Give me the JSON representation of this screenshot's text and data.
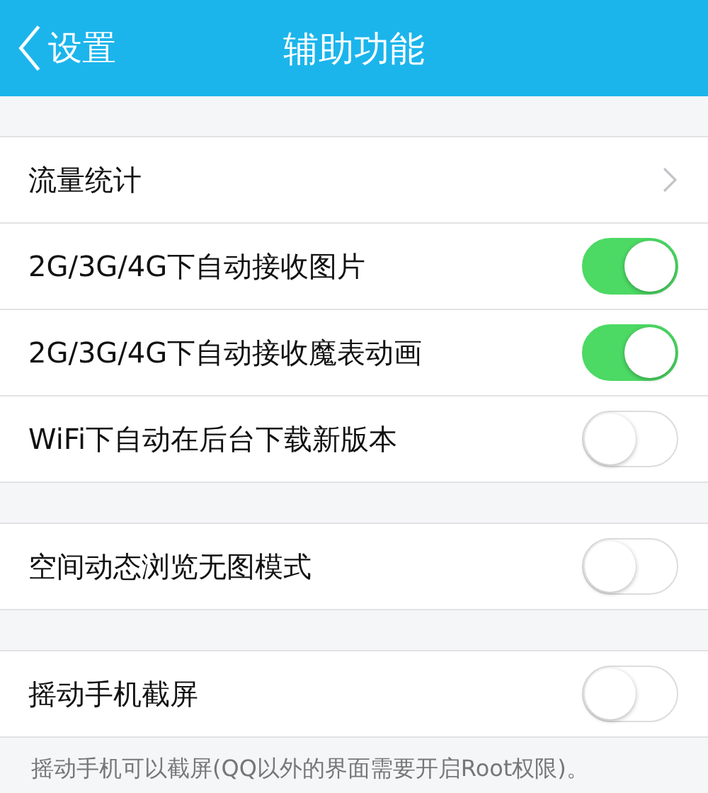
{
  "header": {
    "back_label": "设置",
    "title": "辅助功能"
  },
  "groups": [
    {
      "items": [
        {
          "kind": "link",
          "label": "流量统计"
        },
        {
          "kind": "toggle",
          "label": "2G/3G/4G下自动接收图片",
          "on": true
        },
        {
          "kind": "toggle",
          "label": "2G/3G/4G下自动接收魔表动画",
          "on": true
        },
        {
          "kind": "toggle",
          "label": "WiFi下自动在后台下载新版本",
          "on": false
        }
      ]
    },
    {
      "items": [
        {
          "kind": "toggle",
          "label": "空间动态浏览无图模式",
          "on": false
        }
      ]
    },
    {
      "items": [
        {
          "kind": "toggle",
          "label": "摇动手机截屏",
          "on": false
        }
      ],
      "note": "摇动手机可以截屏(QQ以外的界面需要开启Root权限)。"
    }
  ]
}
